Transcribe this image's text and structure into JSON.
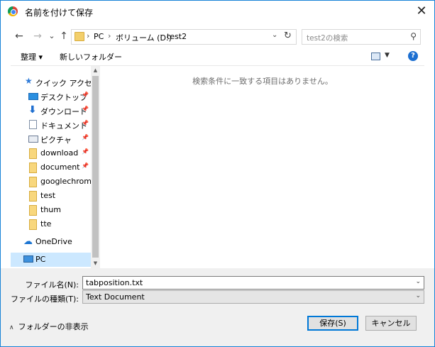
{
  "window": {
    "title": "名前を付けて保存",
    "close_glyph": "✕"
  },
  "nav": {
    "back_glyph": "←",
    "forward_glyph": "→",
    "recent_glyph": "⌄",
    "up_glyph": "↑",
    "crumbs": [
      "PC",
      "ボリューム (D:)",
      "test2"
    ],
    "crumb_sep": "›",
    "dropdown_glyph": "⌄",
    "refresh_glyph": "↻",
    "search_placeholder": "test2の検索",
    "search_glyph": "⚲"
  },
  "toolbar": {
    "organize": "整理 ▾",
    "new_folder": "新しいフォルダー",
    "view_dd": "▼",
    "help": "?"
  },
  "sidebar": {
    "items": [
      {
        "label": "クイック アクセス",
        "icon": "star-icon",
        "pinned": false
      },
      {
        "label": "デスクトップ",
        "icon": "desktop-icon",
        "pinned": true
      },
      {
        "label": "ダウンロード",
        "icon": "download-icon",
        "pinned": true
      },
      {
        "label": "ドキュメント",
        "icon": "document-icon",
        "pinned": true
      },
      {
        "label": "ピクチャ",
        "icon": "pictures-icon",
        "pinned": true
      },
      {
        "label": "download",
        "icon": "folder-icon",
        "pinned": true
      },
      {
        "label": "document",
        "icon": "folder-icon",
        "pinned": true
      },
      {
        "label": "googlechrome",
        "icon": "folder-icon",
        "pinned": false
      },
      {
        "label": "test",
        "icon": "folder-icon",
        "pinned": false
      },
      {
        "label": "thum",
        "icon": "folder-icon",
        "pinned": false
      },
      {
        "label": "tte",
        "icon": "folder-icon",
        "pinned": false
      },
      {
        "label": "OneDrive",
        "icon": "onedrive-icon",
        "pinned": false
      },
      {
        "label": "PC",
        "icon": "pc-icon",
        "pinned": false,
        "selected": true
      }
    ],
    "pin_glyph": "📌",
    "scroll_up": "▲",
    "scroll_down": "▼"
  },
  "filelist": {
    "empty_message": "検索条件に一致する項目はありません。"
  },
  "footer": {
    "filename_label": "ファイル名(N):",
    "filename_value": "tabposition.txt",
    "filetype_label": "ファイルの種類(T):",
    "filetype_value": "Text Document",
    "dd_glyph": "⌄",
    "hide_folders": "フォルダーの非表示",
    "hide_glyph": "∧",
    "save": "保存(S)",
    "cancel": "キャンセル"
  },
  "colors": {
    "accent": "#0078d7",
    "selected_bg": "#cce8ff",
    "footer_bg": "#f0f0f0"
  }
}
